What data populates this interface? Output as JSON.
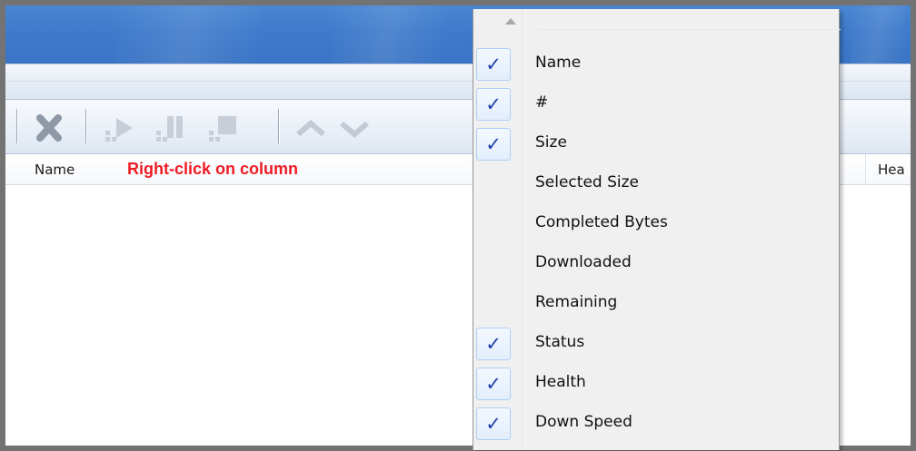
{
  "columns": [
    {
      "label": "Name"
    },
    {
      "label": "Hea"
    }
  ],
  "annotation": "Right-click on column",
  "toolbar": {
    "icons": [
      "remove-icon",
      "start-icon",
      "pause-icon",
      "stop-icon",
      "move-up-icon",
      "move-down-icon"
    ]
  },
  "context_menu": {
    "items": [
      {
        "label": "Name",
        "checked": true
      },
      {
        "label": "#",
        "checked": true
      },
      {
        "label": "Size",
        "checked": true
      },
      {
        "label": "Selected Size",
        "checked": false
      },
      {
        "label": "Completed Bytes",
        "checked": false
      },
      {
        "label": "Downloaded",
        "checked": false
      },
      {
        "label": "Remaining",
        "checked": false
      },
      {
        "label": "Status",
        "checked": true
      },
      {
        "label": "Health",
        "checked": true
      },
      {
        "label": "Down Speed",
        "checked": true
      }
    ],
    "check_glyph": "✓"
  },
  "colors": {
    "annotation": "#ee1c24",
    "titlebar": "#3f7acb",
    "check": "#1d3fa8"
  }
}
